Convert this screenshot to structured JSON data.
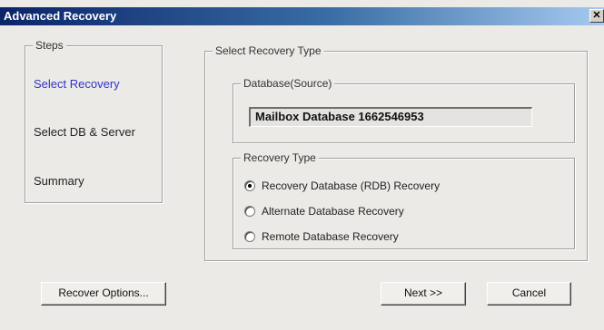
{
  "window": {
    "title": "Advanced Recovery",
    "close_glyph": "✕"
  },
  "steps": {
    "legend": "Steps",
    "items": [
      {
        "label": "Select Recovery",
        "active": true
      },
      {
        "label": "Select DB & Server",
        "active": false
      },
      {
        "label": "Summary",
        "active": false
      }
    ]
  },
  "recovery_type_panel": {
    "legend": "Select Recovery Type",
    "source": {
      "legend": "Database(Source)",
      "value": "Mailbox Database 1662546953"
    },
    "recovery_type": {
      "legend": "Recovery Type",
      "options": [
        {
          "label": "Recovery Database (RDB) Recovery",
          "checked": true
        },
        {
          "label": "Alternate Database Recovery",
          "checked": false
        },
        {
          "label": "Remote Database Recovery",
          "checked": false
        }
      ]
    }
  },
  "buttons": {
    "recover_options": "Recover Options...",
    "next": "Next >>",
    "cancel": "Cancel"
  },
  "colors": {
    "active_step": "#3333cc",
    "titlebar": "#0a246a"
  }
}
